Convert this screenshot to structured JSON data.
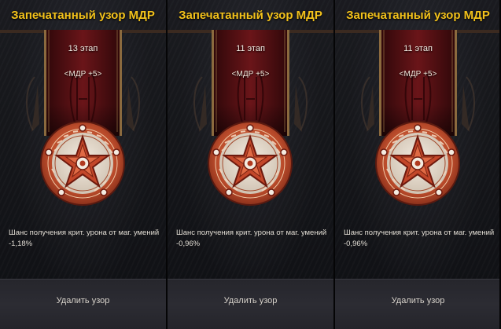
{
  "cards": [
    {
      "title": "Запечатанный узор МДР",
      "stage": "13 этап",
      "bonus": "<МДР +5>",
      "desc_line1": "Шанс получения крит. урона от маг. умений",
      "desc_line2": "-1,18%",
      "remove_label": "Удалить узор"
    },
    {
      "title": "Запечатанный узор МДР",
      "stage": "11 этап",
      "bonus": "<МДР +5>",
      "desc_line1": "Шанс получения крит. урона от маг. умений",
      "desc_line2": "-0,96%",
      "remove_label": "Удалить узор"
    },
    {
      "title": "Запечатанный узор МДР",
      "stage": "11 этап",
      "bonus": "<МДР +5>",
      "desc_line1": "Шанс получения крит. урона от маг. умений",
      "desc_line2": "-0,96%",
      "remove_label": "Удалить узор"
    }
  ],
  "icons": {
    "banner": "rune-banner-icon",
    "medal": "pentagram-seal-icon"
  },
  "colors": {
    "title": "#f3c21b",
    "banner": "#5a1114",
    "medal_ring": "#c1502f",
    "medal_inner": "#e8dccf",
    "footer": "#2c2c33"
  }
}
